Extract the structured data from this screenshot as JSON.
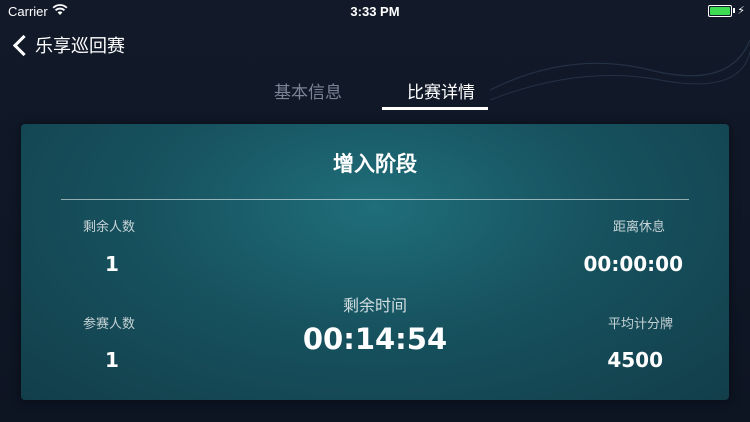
{
  "status_bar": {
    "carrier": "Carrier",
    "time": "3:33 PM",
    "battery_level": 1.0,
    "battery_color": "#3ddc52"
  },
  "nav": {
    "back_title": "乐享巡回赛"
  },
  "tabs": [
    {
      "label": "基本信息",
      "active": false
    },
    {
      "label": "比赛详情",
      "active": true
    }
  ],
  "card": {
    "stage_title": "增入阶段",
    "remaining_players_label": "剩余人数",
    "remaining_players_value": "1",
    "entrants_label": "参赛人数",
    "entrants_value": "1",
    "remaining_time_label": "剩余时间",
    "remaining_time_value": "00:14:54",
    "break_label": "距离休息",
    "break_value": "00:00:00",
    "avg_chips_label": "平均计分牌",
    "avg_chips_value": "4500"
  }
}
